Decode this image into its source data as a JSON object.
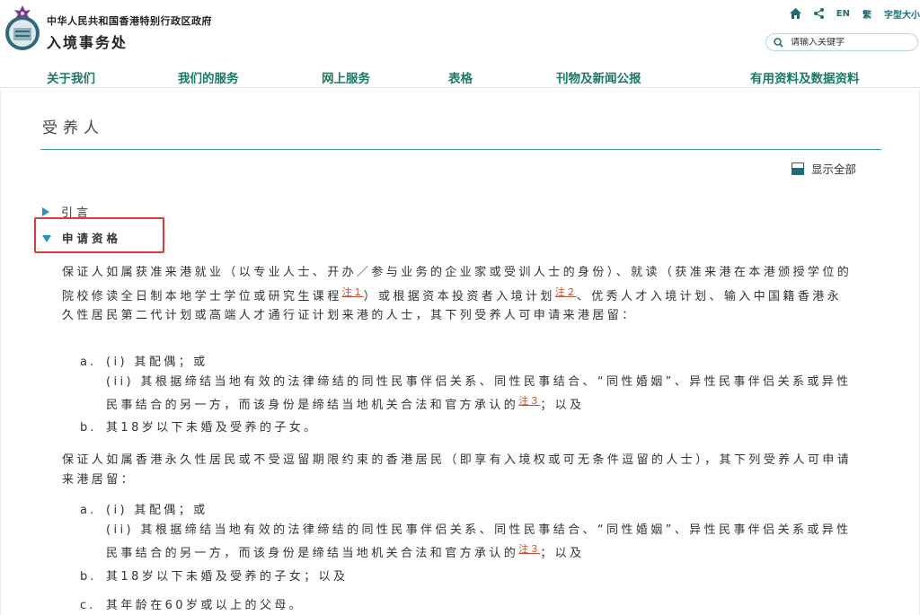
{
  "header": {
    "gov_title": "中华人民共和国香港特别行政区政府",
    "dept_title": "入境事务处",
    "util": {
      "home_icon": "home-icon",
      "share_icon": "share-icon",
      "lang_en": "EN",
      "lang_tc": "繁",
      "font_size": "字型大小"
    },
    "search_placeholder": "请输入关键字"
  },
  "nav": [
    {
      "label": "关于我们"
    },
    {
      "label": "我们的服务"
    },
    {
      "label": "网上服务"
    },
    {
      "label": "表格"
    },
    {
      "label": "刊物及新闻公报"
    },
    {
      "label": "有用资料及数据资料"
    }
  ],
  "page": {
    "title": "受养人",
    "show_all": "显示全部",
    "sections": [
      {
        "label": "引言",
        "expanded": false
      },
      {
        "label": "申请资格",
        "expanded": true
      }
    ],
    "p1": {
      "text_a": "保证人如属获准来港就业（以专业人士、开办／参与业务的企业家或受训人士的身份）、就读（获准来港在本港颁授学位的院校修读全日制本地学士学位或研究生课程",
      "note1": "注１",
      "text_b": "）或根据资本投资者入境计划",
      "note2": "注２",
      "text_c": "、优秀人才入境计划、输入中国籍香港永久性居民第二代计划或高端人才通行证计划来港的人士，其下列受养人可申请来港居留："
    },
    "list1": {
      "a_label": "a.",
      "a_i": "(i) 其配偶；或",
      "a_ii": "(ii) 其根据缔结当地有效的法律缔结的同性民事伴侣关系、同性民事结合、“同性婚姻”、异性民事伴侣关系或异性民事结合的另一方，而该身份是缔结当地机关合法和官方承认的",
      "a_note": "注３",
      "a_tail": "；以及",
      "b_label": "b.",
      "b_text": "其18岁以下未婚及受养的子女。"
    },
    "p2": "保证人如属香港永久性居民或不受逗留期限约束的香港居民（即享有入境权或可无条件逗留的人士），其下列受养人可申请来港居留：",
    "list2": {
      "a_label": "a.",
      "a_i": "(i) 其配偶；或",
      "a_ii": "(ii) 其根据缔结当地有效的法律缔结的同性民事伴侣关系、同性民事结合、“同性婚姻”、异性民事伴侣关系或异性民事结合的另一方，而该身份是缔结当地机关合法和官方承认的",
      "a_note": "注３",
      "a_tail": "；以及",
      "b_label": "b.",
      "b_text": "其18岁以下未婚及受养的子女；以及",
      "c_label": "c.",
      "c_text": "其年龄在60岁或以上的父母。"
    }
  },
  "colors": {
    "nav_green": "#1a7a63",
    "accent_teal": "#1f6b73",
    "rule_teal": "#3fa3a8",
    "triangle_blue": "#2a8fc4",
    "note_orange": "#c44d2d",
    "highlight_red": "#e53935"
  }
}
